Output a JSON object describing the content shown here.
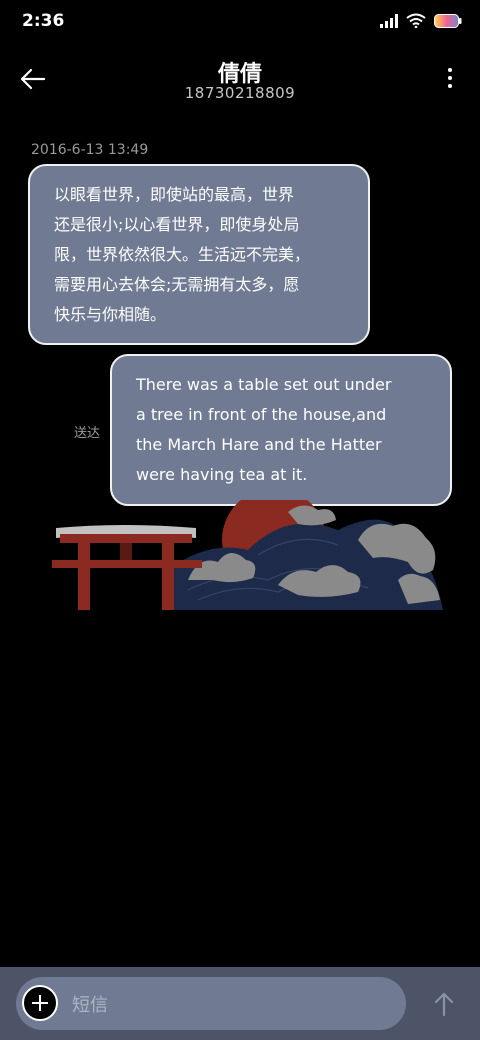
{
  "status_bar": {
    "time": "2:36",
    "icons": [
      "signal-icon",
      "wifi-icon",
      "battery-icon"
    ]
  },
  "header": {
    "back_icon": "back-arrow-icon",
    "contact_name": "倩倩",
    "phone_number": "18730218809",
    "more_icon": "more-vertical-icon"
  },
  "conversation": {
    "timestamp": "2016-6-13 13:49",
    "messages": [
      {
        "direction": "incoming",
        "lines": [
          "以眼看世界，即使站的最高，世界",
          "还是很小;以心看世界，即使身处局",
          "限，世界依然很大。生活远不完美，",
          "需要用心去体会;无需拥有太多，愿",
          "快乐与你相随。"
        ]
      },
      {
        "direction": "outgoing",
        "lines": [
          "There was a table set out under",
          "a tree in front of the house,and",
          "the March Hare and the Hatter",
          "were having tea at it."
        ],
        "status": "送达"
      }
    ]
  },
  "composer": {
    "add_icon": "plus-icon",
    "placeholder": "短信",
    "send_icon": "send-arrow-icon"
  },
  "colors": {
    "background": "#000000",
    "bubble": "#707b93",
    "bubble_border": "#f1f1f1",
    "composer_bar": "#4d5467",
    "art_red": "#8b2a20",
    "art_navy": "#1e2a4a",
    "art_cloud": "#8a8a8a"
  }
}
